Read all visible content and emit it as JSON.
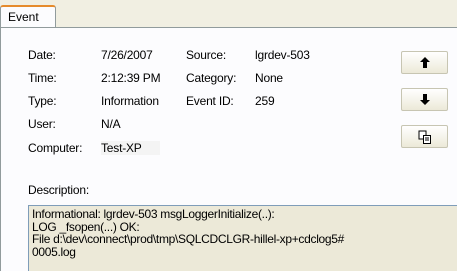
{
  "tab": {
    "label": "Event"
  },
  "fields": {
    "date_label": "Date:",
    "date_value": "7/26/2007",
    "time_label": "Time:",
    "time_value": "2:12:39 PM",
    "type_label": "Type:",
    "type_value": "Information",
    "user_label": "User:",
    "user_value": "N/A",
    "computer_label": "Computer:",
    "computer_value": "Test-XP",
    "source_label": "Source:",
    "source_value": "lgrdev-503",
    "category_label": "Category:",
    "category_value": "None",
    "eventid_label": "Event ID:",
    "eventid_value": "259"
  },
  "buttons": {
    "up_icon": "arrow-up-icon",
    "down_icon": "arrow-down-icon",
    "copy_icon": "copy-icon"
  },
  "description": {
    "label": "Description:",
    "lines": [
      "Informational: lgrdev-503 msgLoggerInitialize(..):",
      "LOG _fsopen(...) OK:",
      "File    d:\\dev\\connect\\prod\\tmp\\SQLCDCLGR-hillel-xp+cdclog5#",
      "0005.log"
    ]
  },
  "colors": {
    "tab_accent": "#e68b2c",
    "panel_bg": "#fcfcfe",
    "description_bg": "#ece9d8"
  }
}
